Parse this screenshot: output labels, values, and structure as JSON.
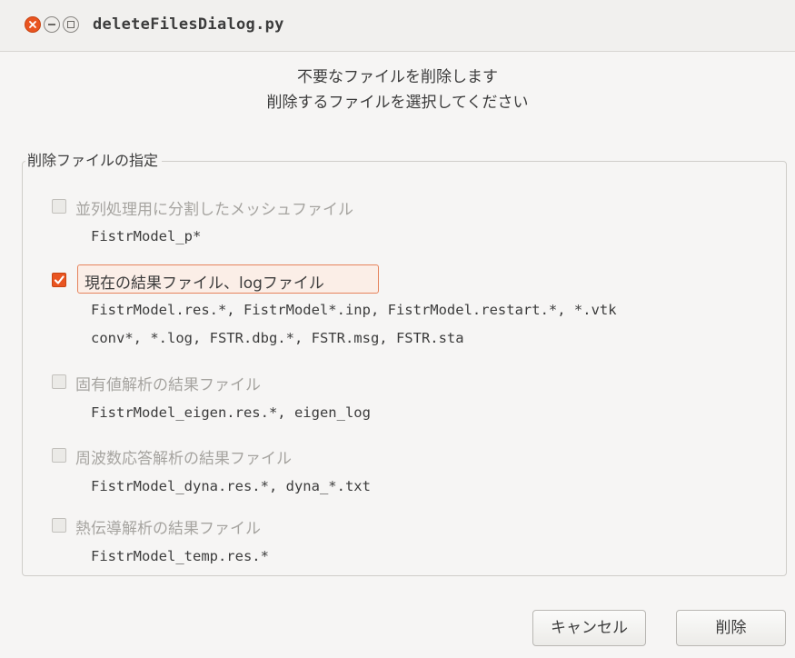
{
  "window": {
    "title": "deleteFilesDialog.py"
  },
  "message": {
    "line1": "不要なファイルを削除します",
    "line2": "削除するファイルを選択してください"
  },
  "group": {
    "title": "削除ファイルの指定",
    "options": [
      {
        "label": "並列処理用に分割したメッシュファイル",
        "checked": false,
        "enabled": false,
        "files": [
          "FistrModel_p*"
        ]
      },
      {
        "label": "現在の結果ファイル、logファイル",
        "checked": true,
        "enabled": true,
        "files": [
          "FistrModel.res.*, FistrModel*.inp, FistrModel.restart.*, *.vtk",
          "conv*, *.log, FSTR.dbg.*, FSTR.msg, FSTR.sta"
        ]
      },
      {
        "label": "固有値解析の結果ファイル",
        "checked": false,
        "enabled": false,
        "files": [
          "FistrModel_eigen.res.*, eigen_log"
        ]
      },
      {
        "label": "周波数応答解析の結果ファイル",
        "checked": false,
        "enabled": false,
        "files": [
          "FistrModel_dyna.res.*, dyna_*.txt"
        ]
      },
      {
        "label": "熱伝導解析の結果ファイル",
        "checked": false,
        "enabled": false,
        "files": [
          "FistrModel_temp.res.*"
        ]
      }
    ]
  },
  "buttons": {
    "cancel": "キャンセル",
    "delete": "削除"
  },
  "colors": {
    "accent": "#e95420",
    "disabled_text": "#a6a4a0"
  }
}
